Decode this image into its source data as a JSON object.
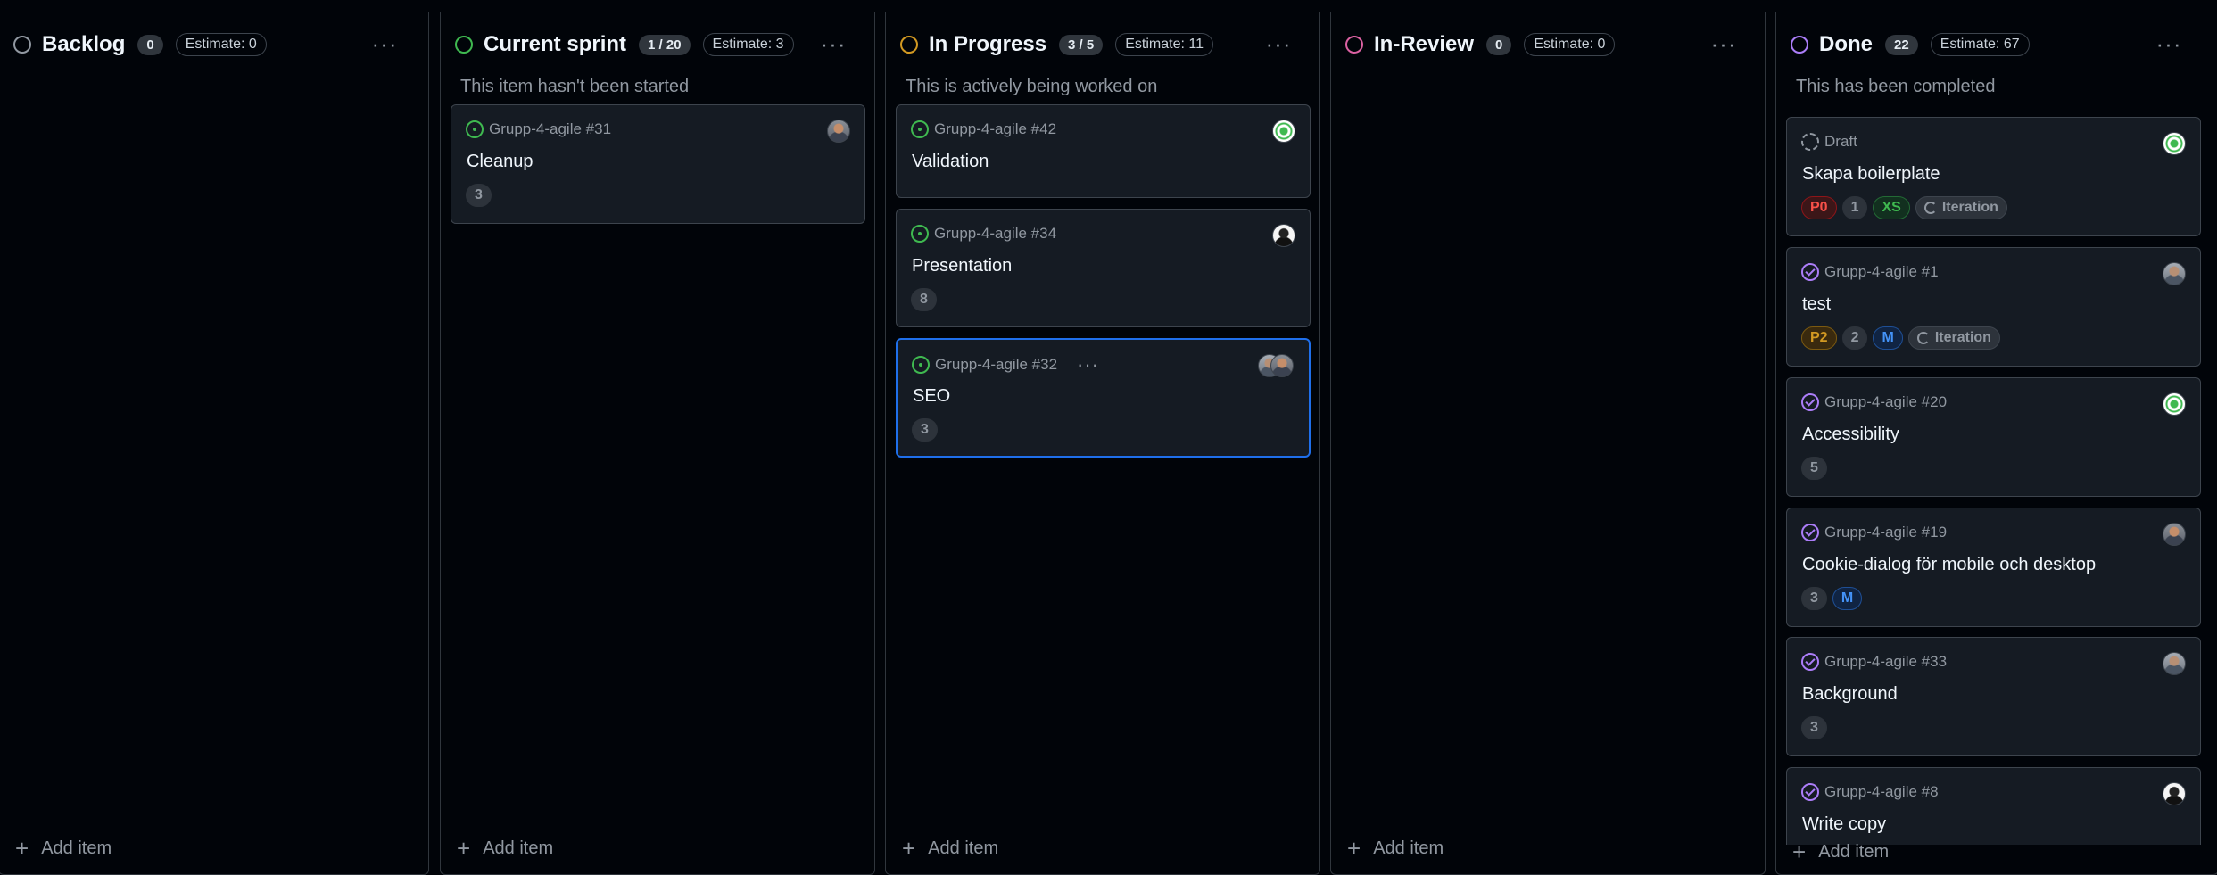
{
  "colors": {
    "backlog": "#9198a1",
    "current_sprint": "#3fb950",
    "in_progress": "#d29922",
    "in_review": "#db61a2",
    "done": "#ab7df8",
    "selected_border": "#1f6feb"
  },
  "columns": [
    {
      "title": "Backlog",
      "count": "0",
      "estimate": "Estimate: 0",
      "description": "",
      "add_label": "Add item",
      "cards": []
    },
    {
      "title": "Current sprint",
      "count": "1 / 20",
      "estimate": "Estimate: 3",
      "description": "This item hasn't been started",
      "add_label": "Add item",
      "cards": [
        {
          "ref": "Grupp-4-agile #31",
          "title": "Cleanup",
          "status_icon": "issue-open-icon",
          "avatar": "user-avatar",
          "tags": [
            "3"
          ]
        }
      ]
    },
    {
      "title": "In Progress",
      "count": "3 / 5",
      "estimate": "Estimate: 11",
      "description": "This is actively being worked on",
      "add_label": "Add item",
      "cards": [
        {
          "ref": "Grupp-4-agile #42",
          "title": "Validation",
          "status_icon": "issue-open-icon",
          "avatar": "identicon-avatar",
          "tags": []
        },
        {
          "ref": "Grupp-4-agile #34",
          "title": "Presentation",
          "status_icon": "issue-open-icon",
          "avatar": "user-avatar",
          "tags": [
            "8"
          ]
        },
        {
          "ref": "Grupp-4-agile #32",
          "title": "SEO",
          "status_icon": "issue-open-icon",
          "avatar": "user-avatar",
          "tags": [
            "3"
          ],
          "selected": true
        }
      ]
    },
    {
      "title": "In-Review",
      "count": "0",
      "estimate": "Estimate: 0",
      "description": "",
      "add_label": "Add item",
      "cards": []
    },
    {
      "title": "Done",
      "count": "22",
      "estimate": "Estimate: 67",
      "description": "This has been completed",
      "add_label": "Add item",
      "cards": [
        {
          "ref": "Draft",
          "title": "Skapa boilerplate",
          "status_icon": "draft-icon",
          "avatar": "identicon-avatar",
          "tags": [
            "P0",
            "1",
            "XS",
            "Iteration"
          ]
        },
        {
          "ref": "Grupp-4-agile #1",
          "title": "test",
          "status_icon": "issue-closed-icon",
          "avatar": "user-avatar",
          "tags": [
            "P2",
            "2",
            "M",
            "Iteration"
          ]
        },
        {
          "ref": "Grupp-4-agile #20",
          "title": "Accessibility",
          "status_icon": "issue-closed-icon",
          "avatar": "identicon-avatar",
          "tags": [
            "5"
          ]
        },
        {
          "ref": "Grupp-4-agile #19",
          "title": "Cookie-dialog för mobile och desktop",
          "status_icon": "issue-closed-icon",
          "avatar": "user-avatar",
          "tags": [
            "3",
            "M"
          ]
        },
        {
          "ref": "Grupp-4-agile #33",
          "title": "Background",
          "status_icon": "issue-closed-icon",
          "avatar": "user-avatar",
          "tags": [
            "3"
          ]
        },
        {
          "ref": "Grupp-4-agile #8",
          "title": "Write copy",
          "status_icon": "issue-closed-icon",
          "avatar": "user-avatar",
          "tags": []
        }
      ]
    }
  ]
}
